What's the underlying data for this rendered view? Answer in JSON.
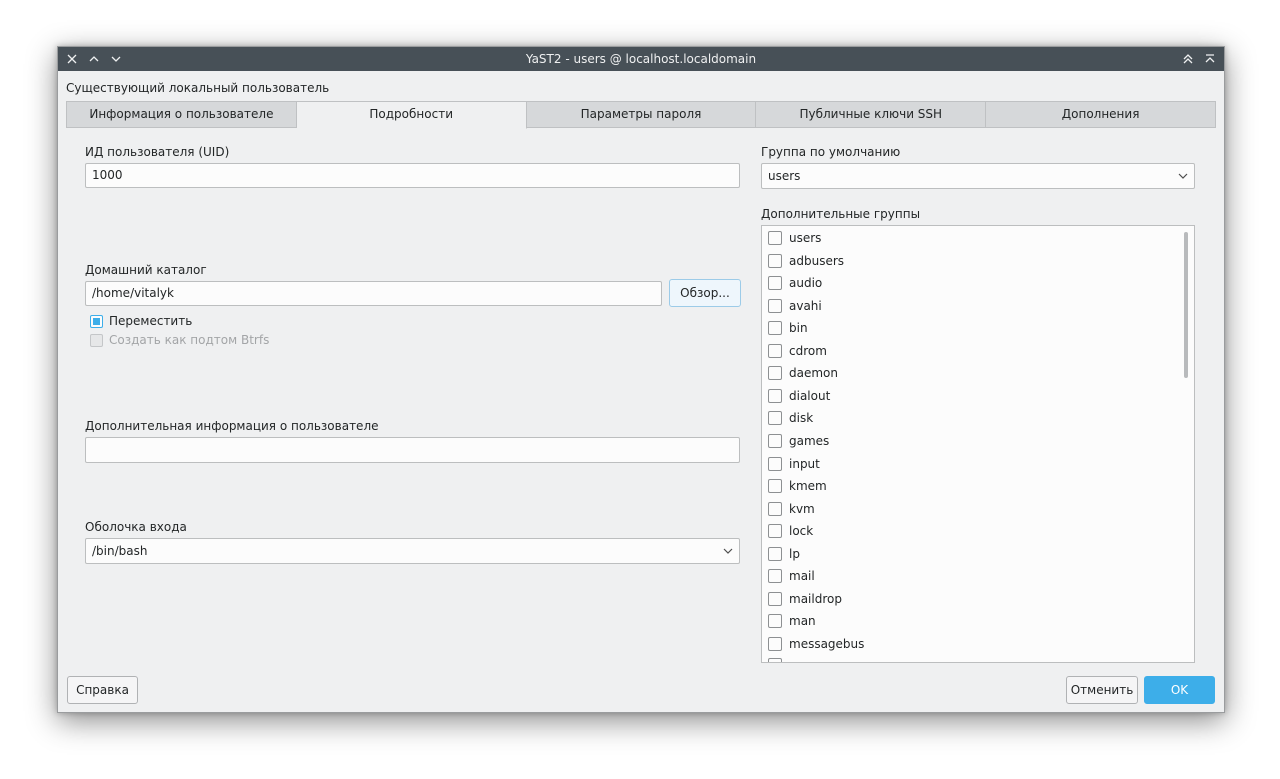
{
  "window": {
    "title": "YaST2 - users @ localhost.localdomain"
  },
  "dialog": {
    "title": "Существующий локальный пользователь"
  },
  "tabs": [
    {
      "label": "Информация о пользователе"
    },
    {
      "label": "Подробности"
    },
    {
      "label": "Параметры пароля"
    },
    {
      "label": "Публичные ключи SSH"
    },
    {
      "label": "Дополнения"
    }
  ],
  "active_tab": 1,
  "uid": {
    "label": "ИД пользователя (UID)",
    "value": "1000"
  },
  "home": {
    "label": "Домашний каталог",
    "value": "/home/vitalyk",
    "browse_label": "Обзор...",
    "move_label": "Переместить",
    "btrfs_label": "Создать как подтом Btrfs"
  },
  "extra_info": {
    "label": "Дополнительная информация о пользователе",
    "value": ""
  },
  "shell": {
    "label": "Оболочка входа",
    "value": "/bin/bash"
  },
  "default_group": {
    "label": "Группа по умолчанию",
    "value": "users"
  },
  "extra_groups": {
    "label": "Дополнительные группы",
    "items": [
      "users",
      "adbusers",
      "audio",
      "avahi",
      "bin",
      "cdrom",
      "daemon",
      "dialout",
      "disk",
      "games",
      "input",
      "kmem",
      "kvm",
      "lock",
      "lp",
      "mail",
      "maildrop",
      "man",
      "messagebus"
    ]
  },
  "footer": {
    "help_label": "Справка",
    "cancel_label": "Отменить",
    "ok_label": "OK"
  },
  "colors": {
    "titlebar": "#475057",
    "accent": "#3daee9",
    "window_bg": "#eff0f1"
  }
}
